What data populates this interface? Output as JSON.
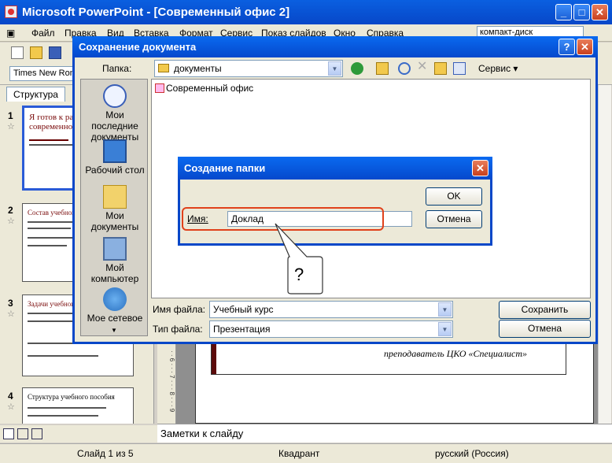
{
  "window": {
    "title": "Microsoft PowerPoint - [Современный офис 2]"
  },
  "menu": {
    "items": [
      "Файл",
      "Правка",
      "Вид",
      "Вставка",
      "Формат",
      "Сервис",
      "Показ слайдов",
      "Окно",
      "Справка"
    ],
    "search_value": "компакт-диск"
  },
  "toolbar": {
    "font_name": "Times New Rom"
  },
  "slides_pane": {
    "tab_outline": "Структура",
    "slide_numbers": [
      "1",
      "2",
      "3",
      "4"
    ],
    "thumb1_title": "Я готов к раб современно",
    "thumb2_title": "Состав учебного",
    "thumb3_title": "Задачи учебного",
    "thumb4_title": "Структура учебного пособия"
  },
  "slide": {
    "footer_text": "преподаватель ЦКО «Специалист»"
  },
  "notes": {
    "placeholder": "Заметки к слайду"
  },
  "status": {
    "slide_info": "Слайд 1 из 5",
    "design": "Квадрант",
    "language": "русский (Россия)"
  },
  "save_dialog": {
    "title": "Сохранение документа",
    "folder_label": "Папка:",
    "folder_value": "документы",
    "tools_label": "Сервис",
    "places": [
      "Мои последние документы",
      "Рабочий стол",
      "Мои документы",
      "Мой компьютер",
      "Мое сетевое"
    ],
    "files": [
      "Современный офис"
    ],
    "filename_label": "Имя файла:",
    "filename_value": "Учебный курс",
    "filetype_label": "Тип файла:",
    "filetype_value": "Презентация",
    "save_button": "Сохранить",
    "cancel_button": "Отмена"
  },
  "new_folder_dialog": {
    "title": "Создание папки",
    "name_label": "Имя:",
    "name_value": "Доклад",
    "ok_button": "OK",
    "cancel_button": "Отмена"
  },
  "callout": {
    "text": "?"
  },
  "colors": {
    "titlebar": "#0747c8",
    "highlight": "#e0411b",
    "dark_red": "#5c0b0b"
  }
}
